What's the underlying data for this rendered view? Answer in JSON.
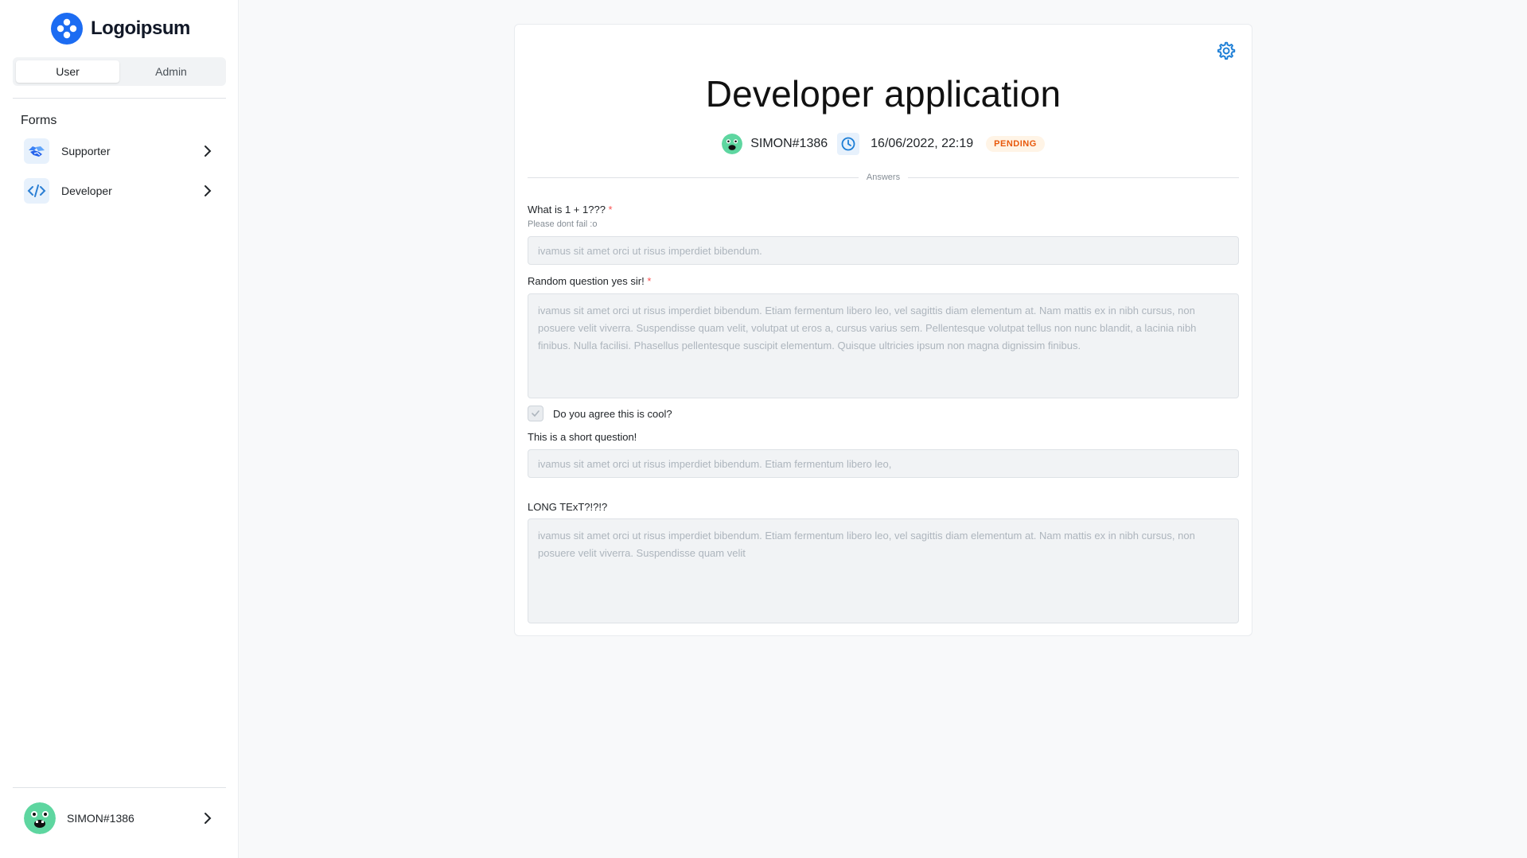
{
  "brand": {
    "name": "Logoipsum",
    "accent": "#1c6cf2"
  },
  "sidebar": {
    "segments": [
      {
        "label": "User",
        "active": true
      },
      {
        "label": "Admin",
        "active": false
      }
    ],
    "section_title": "Forms",
    "items": [
      {
        "label": "Supporter",
        "icon": "handshake-icon"
      },
      {
        "label": "Developer",
        "icon": "code-icon"
      }
    ],
    "user": {
      "name": "SIMON#1386"
    }
  },
  "application": {
    "title": "Developer application",
    "user": "SIMON#1386",
    "datetime": "16/06/2022, 22:19",
    "status": "PENDING",
    "separator_label": "Answers"
  },
  "questions": [
    {
      "label": "What is 1 + 1???",
      "required": "*",
      "description": "Please dont fail :o",
      "answer": "ivamus sit amet orci ut risus imperdiet bibendum."
    },
    {
      "label": "Random question yes sir!",
      "required": "*",
      "answer": "ivamus sit amet orci ut risus imperdiet bibendum. Etiam fermentum libero leo, vel sagittis diam elementum at. Nam mattis ex in nibh cursus, non posuere velit viverra. Suspendisse quam velit, volutpat ut eros a, cursus varius sem. Pellentesque volutpat tellus non nunc blandit, a lacinia nibh finibus. Nulla facilisi. Phasellus pellentesque suscipit elementum. Quisque ultricies ipsum non magna dignissim finibus."
    },
    {
      "label": "Do you agree this is cool?",
      "type": "checkbox",
      "checked": true
    },
    {
      "label": "This is a short question!",
      "answer": "ivamus sit amet orci ut risus imperdiet bibendum. Etiam fermentum libero leo,"
    },
    {
      "label": "LONG TExT?!?!?",
      "answer": "ivamus sit amet orci ut risus imperdiet bibendum. Etiam fermentum libero leo, vel sagittis diam elementum at. Nam mattis ex in nibh cursus, non posuere velit viverra. Suspendisse quam velit"
    }
  ]
}
